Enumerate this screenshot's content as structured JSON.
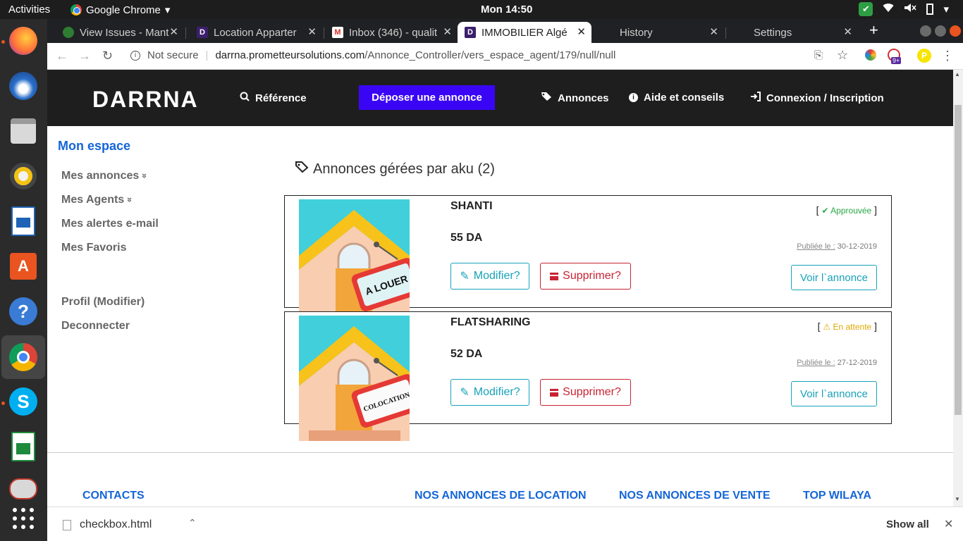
{
  "os": {
    "activities": "Activities",
    "app_menu": "Google Chrome",
    "clock": "Mon 14:50"
  },
  "browser": {
    "tabs": [
      {
        "title": "View Issues - Mant",
        "favicon": "bug-icon"
      },
      {
        "title": "Location Apparter",
        "favicon": "D"
      },
      {
        "title": "Inbox (346) - qualit",
        "favicon": "M"
      },
      {
        "title": "IMMOBILIER Algé",
        "favicon": "D",
        "active": true
      },
      {
        "title": "History",
        "favicon": "history-icon"
      },
      {
        "title": "Settings",
        "favicon": "gear-icon"
      }
    ],
    "security": "Not secure",
    "url_host": "darrna.prometteursolutions.com",
    "url_path": "/Annonce_Controller/vers_espace_agent/179/null/null",
    "extension_badge": "9+"
  },
  "site": {
    "logo": "DARRNA",
    "nav": {
      "reference": "Référence",
      "post_ad": "Déposer une annonce",
      "ads": "Annonces",
      "help": "Aide et conseils",
      "login": "Connexion / Inscription"
    }
  },
  "sidebar": {
    "title": "Mon espace",
    "items": [
      {
        "label": "Mes annonces",
        "chevron": "»"
      },
      {
        "label": "Mes Agents",
        "chevron": "»"
      },
      {
        "label": "Mes alertes e-mail"
      },
      {
        "label": "Mes Favoris"
      }
    ],
    "profile": "Profil (Modifier)",
    "logout": "Deconnecter"
  },
  "main": {
    "title": "Annonces gérées par aku (2)",
    "cards": [
      {
        "title": "SHANTI",
        "price": "55 DA",
        "status": "Approuvée",
        "status_color": "#28a745",
        "published_label": "Publiée le :",
        "published_date": "30-12-2019",
        "sign_text": "A LOUER",
        "edit_label": "Modifier?",
        "delete_label": "Supprimer?",
        "view_label": "Voir l`annonce"
      },
      {
        "title": "FLATSHARING",
        "price": "52 DA",
        "status": "En attente",
        "status_color": "#e0a800",
        "published_label": "Publiée le :",
        "published_date": "27-12-2019",
        "sign_text": "COLOCATION",
        "edit_label": "Modifier?",
        "delete_label": "Supprimer?",
        "view_label": "Voir l`annonce"
      }
    ]
  },
  "footer": {
    "contacts": "CONTACTS",
    "rent": "NOS ANNONCES DE LOCATION",
    "sale": "NOS ANNONCES DE VENTE",
    "top": "TOP WILAYA"
  },
  "download_bar": {
    "file": "checkbox.html",
    "show_all": "Show all"
  }
}
